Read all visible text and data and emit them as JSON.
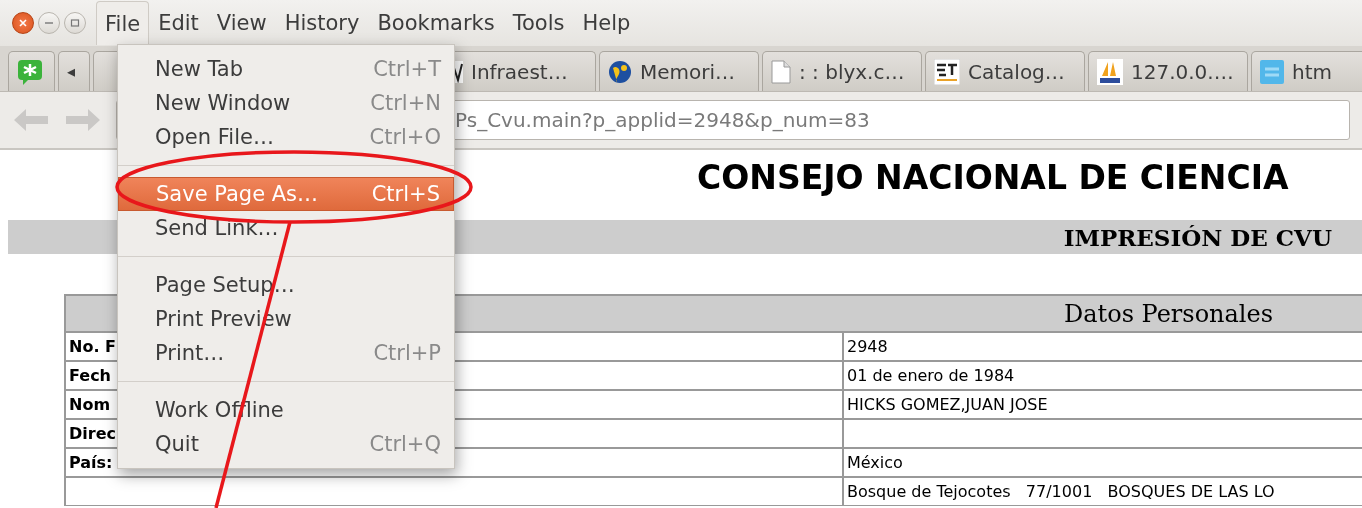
{
  "menu_bar": [
    {
      "label": "File",
      "selected": true
    },
    {
      "label": "Edit",
      "selected": false
    },
    {
      "label": "View",
      "selected": false
    },
    {
      "label": "History",
      "selected": false
    },
    {
      "label": "Bookmarks",
      "selected": false
    },
    {
      "label": "Tools",
      "selected": false
    },
    {
      "label": "Help",
      "selected": false
    }
  ],
  "tabs": [
    {
      "kind": "pinned"
    },
    {
      "kind": "scroll",
      "label": "◂"
    },
    {
      "kind": "hidden"
    },
    {
      "kind": "tab",
      "label": "Infraest…"
    },
    {
      "kind": "tab",
      "label": "Memori…"
    },
    {
      "kind": "tab",
      "label": ": : blyx.c…"
    },
    {
      "kind": "tab",
      "label": "Catalog…"
    },
    {
      "kind": "tab",
      "label": "127.0.0.…"
    },
    {
      "kind": "tab",
      "label": "htm"
    }
  ],
  "address_bar": {
    "url": "Ps_Cvu.main?p_applid=2948&p_num=83",
    "back_disabled": true,
    "forward_disabled": true
  },
  "file_menu": [
    {
      "kind": "item",
      "label": "New Tab",
      "shortcut": "Ctrl+T",
      "selected": false
    },
    {
      "kind": "item",
      "label": "New Window",
      "shortcut": "Ctrl+N",
      "selected": false
    },
    {
      "kind": "item",
      "label": "Open File…",
      "shortcut": "Ctrl+O",
      "selected": false
    },
    {
      "kind": "separator"
    },
    {
      "kind": "item",
      "label": "Save Page As…",
      "shortcut": "Ctrl+S",
      "selected": true
    },
    {
      "kind": "item",
      "label": "Send Link…",
      "selected": false
    },
    {
      "kind": "separator"
    },
    {
      "kind": "item",
      "label": "Page Setup…",
      "selected": false
    },
    {
      "kind": "item",
      "label": "Print Preview",
      "selected": false
    },
    {
      "kind": "item",
      "label": "Print…",
      "shortcut": "Ctrl+P",
      "selected": false
    },
    {
      "kind": "separator"
    },
    {
      "kind": "item",
      "label": "Work Offline",
      "selected": false
    },
    {
      "kind": "item",
      "label": "Quit",
      "shortcut": "Ctrl+Q",
      "selected": false
    }
  ],
  "page": {
    "title": "CONSEJO NACIONAL DE CIENCIA",
    "subtitle": "IMPRESIÓN DE CVU",
    "section": "Datos Personales",
    "rows": [
      {
        "label": "No. F",
        "value": "2948"
      },
      {
        "label": "Fech",
        "value": "01 de enero de 1984"
      },
      {
        "label": "Nom",
        "value": "HICKS GOMEZ,JUAN JOSE"
      },
      {
        "label": "Direc"
      },
      {
        "label": "País:",
        "value": "México"
      },
      {
        "value": "Bosque de Tejocotes   77/1001   BOSQUES DE LAS LO"
      }
    ]
  },
  "annotation": {
    "kind": "ellipse-with-line",
    "color": "#e8171b"
  }
}
